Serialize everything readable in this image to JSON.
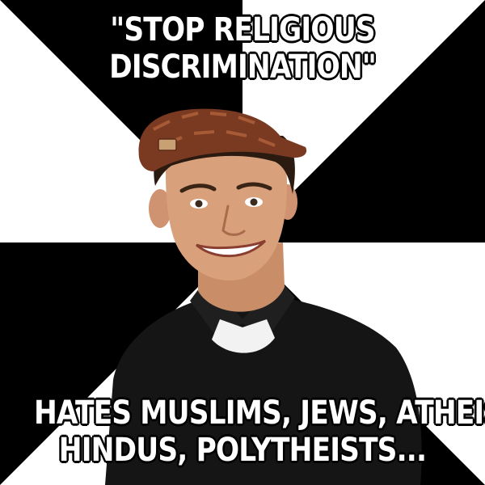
{
  "meme": {
    "top_text": [
      "\"STOP RELIGIOUS",
      "DISCRIMINATION\""
    ],
    "bottom_text": [
      "HATES MUSLIMS, JEWS, ATHEISTS,",
      "HINDUS, POLYTHEISTS..."
    ]
  },
  "colors": {
    "background_dark": "#000000",
    "background_light": "#ffffff",
    "caption_text": "#ffffff",
    "caption_outline": "#000000",
    "hat": "#7a3a22",
    "shirt": "#151515",
    "undershirt": "#f2f2f2",
    "skin": "#d9a07c"
  }
}
